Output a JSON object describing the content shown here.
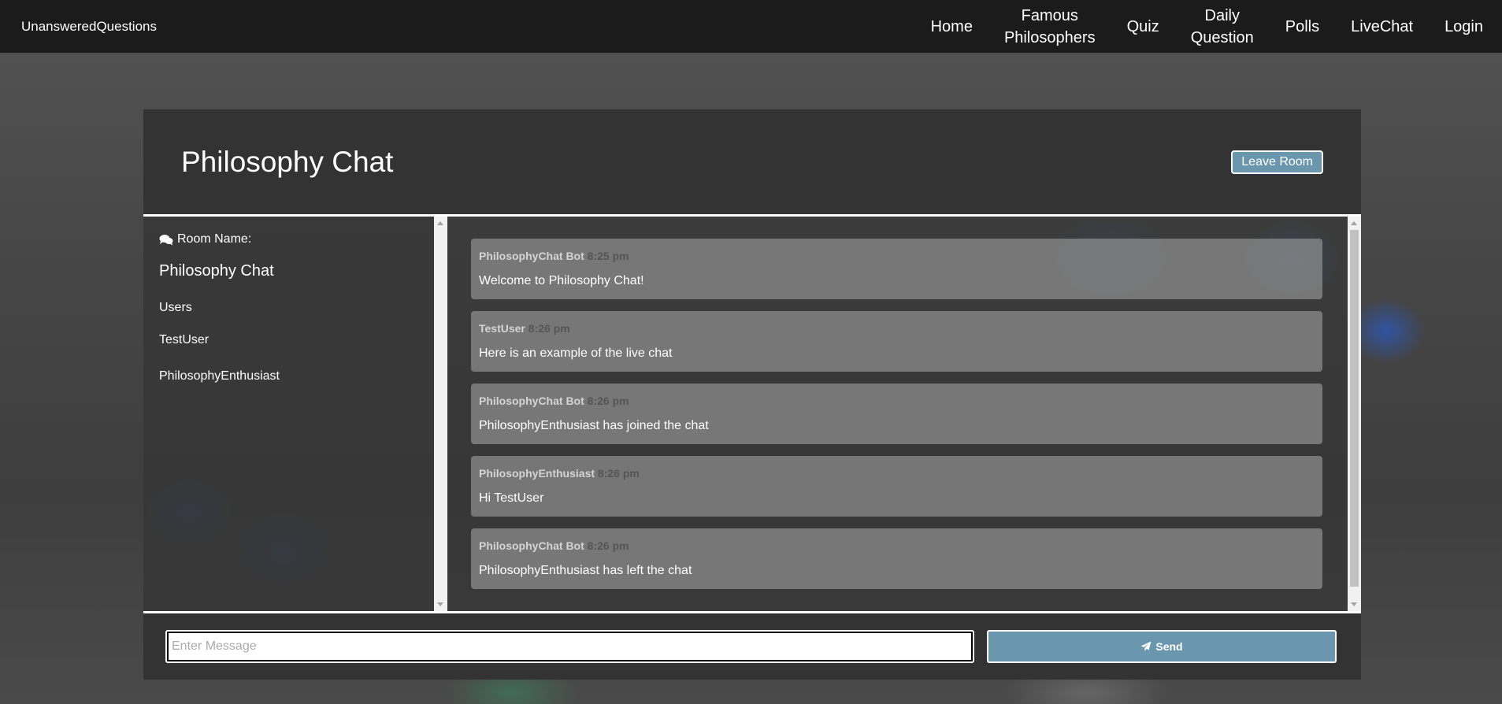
{
  "navbar": {
    "brand": "UnansweredQuestions",
    "links": [
      {
        "line1": "Home",
        "line2": ""
      },
      {
        "line1": "Famous",
        "line2": "Philosophers"
      },
      {
        "line1": "Quiz",
        "line2": ""
      },
      {
        "line1": "Daily",
        "line2": "Question"
      },
      {
        "line1": "Polls",
        "line2": ""
      },
      {
        "line1": "LiveChat",
        "line2": ""
      },
      {
        "line1": "Login",
        "line2": ""
      }
    ]
  },
  "chat": {
    "title": "Philosophy Chat",
    "leave_label": "Leave Room",
    "room_label": "Room Name:",
    "room_name": "Philosophy Chat",
    "users_heading": "Users",
    "users": [
      "TestUser",
      "PhilosophyEnthusiast"
    ],
    "messages": [
      {
        "user": "PhilosophyChat Bot",
        "time": "8:25 pm",
        "text": "Welcome to Philosophy Chat!"
      },
      {
        "user": "TestUser",
        "time": "8:26 pm",
        "text": "Here is an example of the live chat"
      },
      {
        "user": "PhilosophyChat Bot",
        "time": "8:26 pm",
        "text": "PhilosophyEnthusiast has joined the chat"
      },
      {
        "user": "PhilosophyEnthusiast",
        "time": "8:26 pm",
        "text": "Hi TestUser"
      },
      {
        "user": "PhilosophyChat Bot",
        "time": "8:26 pm",
        "text": "PhilosophyEnthusiast has left the chat"
      }
    ],
    "input_placeholder": "Enter Message",
    "input_value": "",
    "send_label": "Send"
  },
  "icons": {
    "room": "comments-icon",
    "send": "paper-plane-icon"
  },
  "colors": {
    "navbar": "#1b1b1b",
    "panel": "#333333",
    "button": "#6b97ae"
  }
}
